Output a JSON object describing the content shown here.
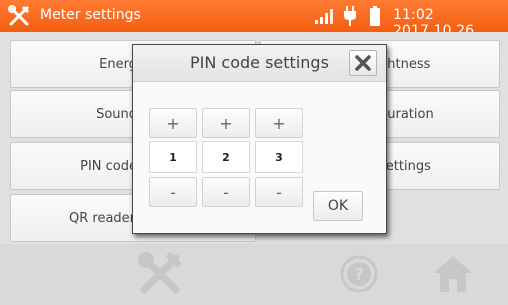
{
  "header": {
    "title": "Meter settings",
    "clock": "11:02 2017.10.26",
    "icons": [
      "tools-icon",
      "signal-icon",
      "plug-icon",
      "battery-icon"
    ]
  },
  "menu": {
    "left": [
      "Energ",
      "Sound",
      "PIN code",
      "QR reader"
    ],
    "right": [
      "ghtness",
      "guration",
      "settings"
    ]
  },
  "dialog": {
    "title": "PIN code settings",
    "plus_label": "+",
    "minus_label": "-",
    "digits": [
      "1",
      "2",
      "3"
    ],
    "ok_label": "OK"
  },
  "toolbar": {
    "icons": [
      "settings-tools-icon",
      "help-icon",
      "home-icon"
    ]
  },
  "colors": {
    "header": "#f4661a",
    "toolbar_icons": "#c7c7c7"
  }
}
